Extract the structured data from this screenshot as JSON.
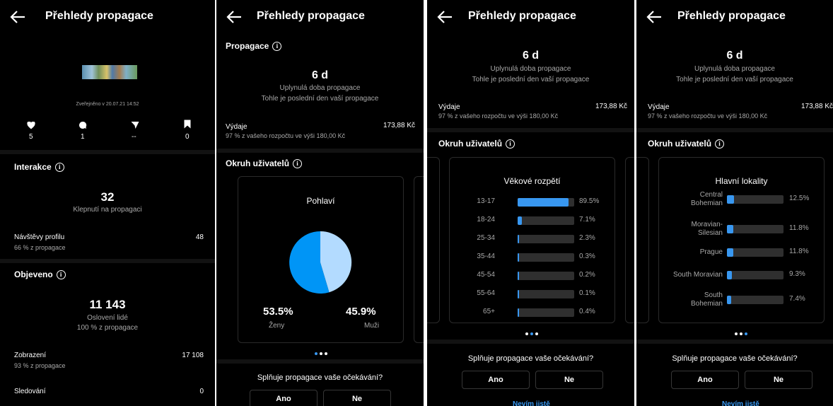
{
  "header": {
    "title": "Přehledy propagace"
  },
  "post": {
    "published": "Zveřejněno v 20.07.21 14:52",
    "stats": [
      {
        "icon": "heart-icon",
        "value": "5"
      },
      {
        "icon": "comment-icon",
        "value": "1"
      },
      {
        "icon": "share-icon",
        "value": "--"
      },
      {
        "icon": "bookmark-icon",
        "value": "0"
      }
    ]
  },
  "interactions": {
    "heading": "Interakce",
    "big_value": "32",
    "big_label": "Klepnutí na propagaci",
    "profile_visits_label": "Návštěvy profilu",
    "profile_visits_sub": "66 % z propagace",
    "profile_visits_value": "48"
  },
  "discovered": {
    "heading": "Objeveno",
    "big_value": "11 143",
    "big_label": "Oslovení lidé",
    "big_sub": "100 % z propagace",
    "impressions_label": "Zobrazení",
    "impressions_sub": "93 % z propagace",
    "impressions_value": "17 108",
    "follows_label": "Sledování",
    "follows_value": "0"
  },
  "promotion": {
    "heading": "Propagace",
    "duration": "6 d",
    "duration_label": "Uplynulá doba propagace",
    "duration_note": "Tohle je poslední den vaší propagace",
    "spend_label": "Výdaje",
    "spend_sub": "97 % z vašeho rozpočtu ve výši 180,00 Kč",
    "spend_value": "173,88 Kč"
  },
  "audience": {
    "heading": "Okruh uživatelů",
    "gender": {
      "title": "Pohlaví",
      "women_pct": "53.5%",
      "women_label": "Ženy",
      "men_pct": "45.9%",
      "men_label": "Muži",
      "colors": {
        "women": "#0095f6",
        "men": "#b3dbff"
      }
    },
    "age": {
      "title": "Věkové rozpětí",
      "rows": [
        {
          "label": "13-17",
          "value": 89.5,
          "text": "89.5%"
        },
        {
          "label": "18-24",
          "value": 7.1,
          "text": "7.1%"
        },
        {
          "label": "25-34",
          "value": 2.3,
          "text": "2.3%"
        },
        {
          "label": "35-44",
          "value": 0.3,
          "text": "0.3%"
        },
        {
          "label": "45-54",
          "value": 0.2,
          "text": "0.2%"
        },
        {
          "label": "55-64",
          "value": 0.1,
          "text": "0.1%"
        },
        {
          "label": "65+",
          "value": 0.4,
          "text": "0.4%"
        }
      ]
    },
    "locations": {
      "title": "Hlavní lokality",
      "rows": [
        {
          "label_lines": [
            "Central",
            "Bohemian"
          ],
          "value": 12.5,
          "text": "12.5%"
        },
        {
          "label_lines": [
            "Moravian-",
            "Silesian"
          ],
          "value": 11.8,
          "text": "11.8%"
        },
        {
          "label_lines": [
            "Prague"
          ],
          "value": 11.8,
          "text": "11.8%"
        },
        {
          "label_lines": [
            "South Moravian"
          ],
          "value": 9.3,
          "text": "9.3%"
        },
        {
          "label_lines": [
            "South",
            "Bohemian"
          ],
          "value": 7.4,
          "text": "7.4%"
        }
      ]
    }
  },
  "feedback": {
    "question": "Splňuje propagace vaše očekávání?",
    "yes": "Ano",
    "no": "Ne",
    "unsure": "Nevím jistě"
  }
}
